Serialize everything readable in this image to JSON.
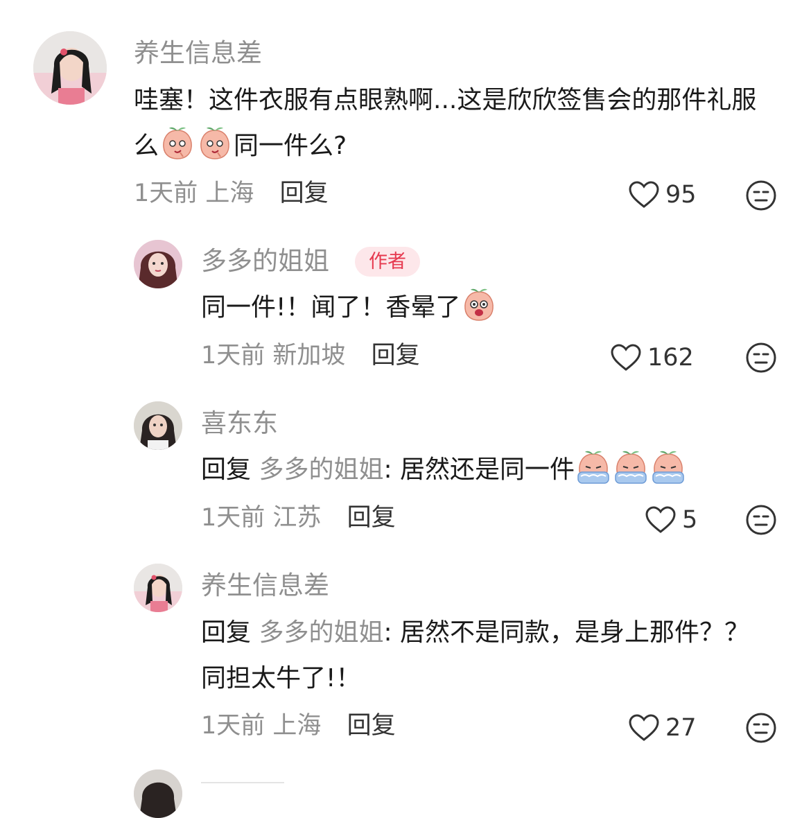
{
  "comments": [
    {
      "name": "养生信息差",
      "text_before": "哇塞！这件衣服有点眼熟啊...这是欣欣签售会的那件礼服么",
      "text_after": "同一件么?",
      "time": "1天前",
      "location": "上海",
      "reply_label": "回复",
      "likes": "95"
    },
    {
      "name": "多多的姐姐",
      "badge": "作者",
      "text": "同一件!！闻了！香晕了",
      "time": "1天前",
      "location": "新加坡",
      "reply_label": "回复",
      "likes": "162"
    },
    {
      "name": "喜东东",
      "reply_prefix": "回复",
      "reply_target": "多多的姐姐",
      "text": ": 居然还是同一件",
      "time": "1天前",
      "location": "江苏",
      "reply_label": "回复",
      "likes": "5"
    },
    {
      "name": "养生信息差",
      "reply_prefix": "回复",
      "reply_target": "多多的姐姐",
      "text": ": 居然不是同款，是身上那件？？同担太牛了!！",
      "time": "1天前",
      "location": "上海",
      "reply_label": "回复",
      "likes": "27"
    }
  ],
  "icons": {
    "like": "heart-outline-icon",
    "dislike": "neutral-face-icon",
    "emoji_a": "peach-smirk-emoji",
    "emoji_b": "peach-shocked-emoji",
    "emoji_c": "peach-crying-emoji"
  },
  "colors": {
    "author_badge_bg": "#fde7ea",
    "author_badge_text": "#e6394f",
    "muted_text": "#8f8f8f"
  }
}
